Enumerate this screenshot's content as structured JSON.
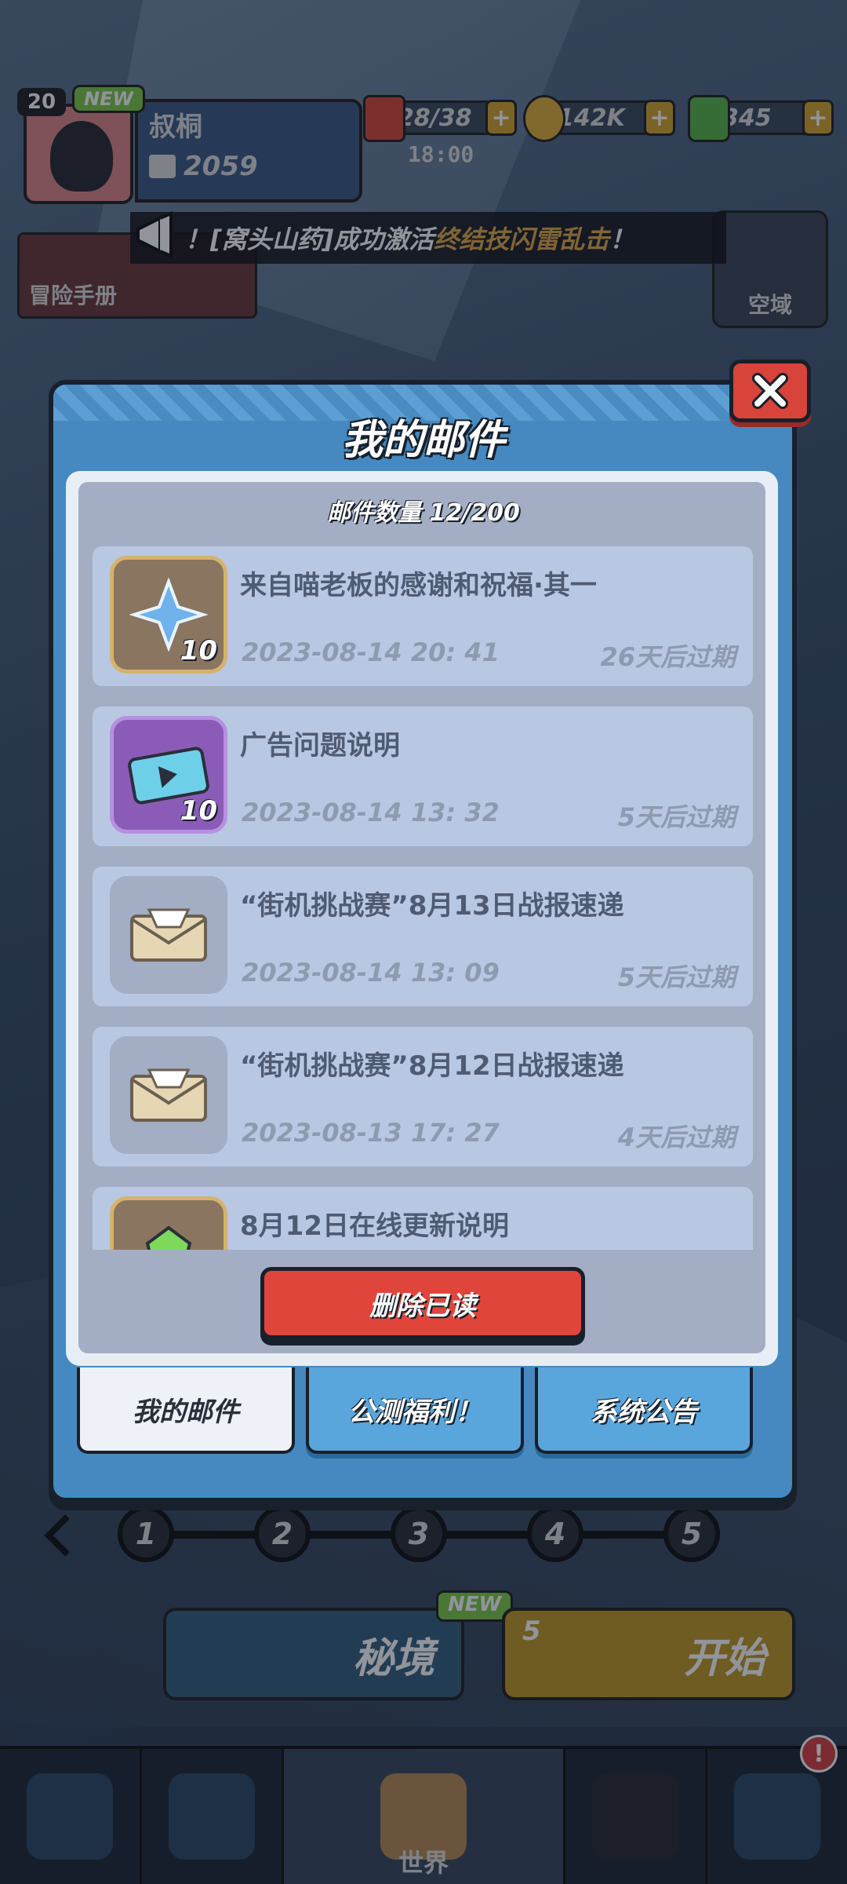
{
  "player": {
    "level": "20",
    "new_tag": "NEW",
    "name": "叔桐",
    "power": "2059"
  },
  "resources": {
    "stamina": "28/38",
    "stamina_timer": "18:00",
    "coins": "142K",
    "gems": "345",
    "plus": "+"
  },
  "notice": {
    "part1": "！[窝头山药]成功激活",
    "part2": "终结技闪雷乱击",
    "part3": "！"
  },
  "side": {
    "adventure_book": "冒险手册",
    "airspace": "空域"
  },
  "modal": {
    "title": "我的邮件",
    "close": "×",
    "count": "邮件数量 12/200",
    "delete_label": "删除已读"
  },
  "mails": [
    {
      "title": "来自喵老板的感谢和祝福·其一",
      "date": "2023-08-14 20: 41",
      "expire": "26天后过期",
      "qty": "10",
      "icon": "blue-crystal-icon"
    },
    {
      "title": "广告问题说明",
      "date": "2023-08-14 13: 32",
      "expire": "5天后过期",
      "qty": "10",
      "icon": "ticket-icon"
    },
    {
      "title": "“街机挑战赛”8月13日战报速递",
      "date": "2023-08-14 13: 09",
      "expire": "5天后过期",
      "qty": "",
      "icon": "envelope-icon"
    },
    {
      "title": "“街机挑战赛”8月12日战报速递",
      "date": "2023-08-13 17: 27",
      "expire": "4天后过期",
      "qty": "",
      "icon": "envelope-icon"
    },
    {
      "title": "8月12日在线更新说明",
      "date": "",
      "expire": "",
      "qty": "",
      "icon": "green-gem-icon"
    }
  ],
  "tabs": [
    {
      "label": "我的邮件",
      "active": true
    },
    {
      "label": "公测福利！",
      "active": false
    },
    {
      "label": "系统公告",
      "active": false
    }
  ],
  "stages": [
    "1",
    "2",
    "3",
    "4",
    "5"
  ],
  "modes": {
    "secret": "秘境",
    "secret_new": "NEW",
    "start": "开始",
    "start_cost": "5"
  },
  "nav": {
    "world": "世界",
    "badge": "!"
  },
  "colors": {
    "modal_blue": "#4589c0",
    "delete_red": "#e0453c",
    "mail_card": "#b9c8e2",
    "expire_text": "#8e9ab0"
  }
}
